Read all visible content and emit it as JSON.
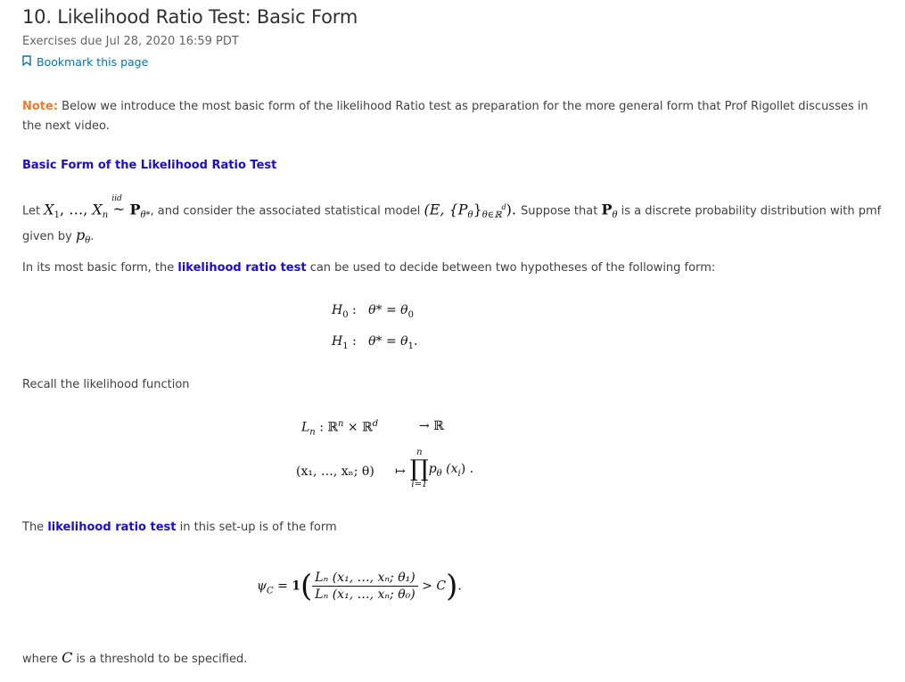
{
  "header": {
    "title": "10. Likelihood Ratio Test: Basic Form",
    "due": "Exercises due Jul 28, 2020 16:59 PDT",
    "bookmark_label": "Bookmark this page",
    "bookmark_icon": "bookmark-icon"
  },
  "colors": {
    "note": "#f07b2c",
    "emphasis": "#1a0dcc",
    "link": "#0075b4",
    "text": "#414141"
  },
  "note": {
    "label": "Note:",
    "text": " Below we introduce the most basic form of the likelihood Ratio test as preparation for the more general form that Prof Rigollet discusses in the next video."
  },
  "section_heading": "Basic Form of the Likelihood Ratio Test",
  "intro": {
    "let": "Let ",
    "X1": "X",
    "sub1": "1",
    "dots": ", …, ",
    "Xn": "X",
    "subn": "n",
    "iid": "iid",
    "tilde": "~",
    "P": "P",
    "theta_star": "θ*",
    "after_dist": ", and consider the associated statistical model ",
    "model": "(E, {P",
    "model_sub": "θ∈ℝ",
    "model_sup": "d",
    "model_close": "). ",
    "suppose": "Suppose that ",
    "P2": "P",
    "theta": "θ",
    "rest": " is a discrete probability distribution with pmf given by ",
    "p": "p",
    "end": "."
  },
  "hypotheses_intro": {
    "before": "In its most basic form, the ",
    "emph": "likelihood ratio test",
    "after": " can be used to decide between two hypotheses of the following form:"
  },
  "hypotheses": [
    {
      "label": "H",
      "sub": "0",
      "colon": " :",
      "lhs": "θ* = θ",
      "rhs_sub": "0",
      "end": ""
    },
    {
      "label": "H",
      "sub": "1",
      "colon": " :",
      "lhs": "θ* = θ",
      "rhs_sub": "1",
      "end": "."
    }
  ],
  "recall": "Recall the likelihood function",
  "likelihood": {
    "line1_left": "L",
    "line1_sub": "n",
    "line1_mid": " : ℝ",
    "line1_sup1": "n",
    "line1_times": " × ℝ",
    "line1_sup2": "d",
    "line1_arrow": "→ ℝ",
    "line2_left": "(x₁, …, xₙ; θ)",
    "line2_arrow": "↦",
    "prod_top": "n",
    "prod_sym": "∏",
    "prod_bottom": "i=1",
    "line2_right": "p",
    "line2_right_sub": "θ",
    "line2_right_arg": " (x",
    "line2_right_arg_sub": "i",
    "line2_right_end": ") ."
  },
  "test_intro": {
    "before": "The ",
    "emph": "likelihood ratio test",
    "after": " in this set-up is of the form"
  },
  "test_formula": {
    "psi": "ψ",
    "psi_sub": "C",
    "eq": " = ",
    "indicator": "1",
    "numerator": "Lₙ (x₁, …, xₙ; θ₁)",
    "denominator": "Lₙ (x₁, …, xₙ; θ₀)",
    "compare": " > C",
    "end": "."
  },
  "threshold": {
    "before": "where ",
    "C": "C",
    "after": " is a threshold to be specified."
  }
}
